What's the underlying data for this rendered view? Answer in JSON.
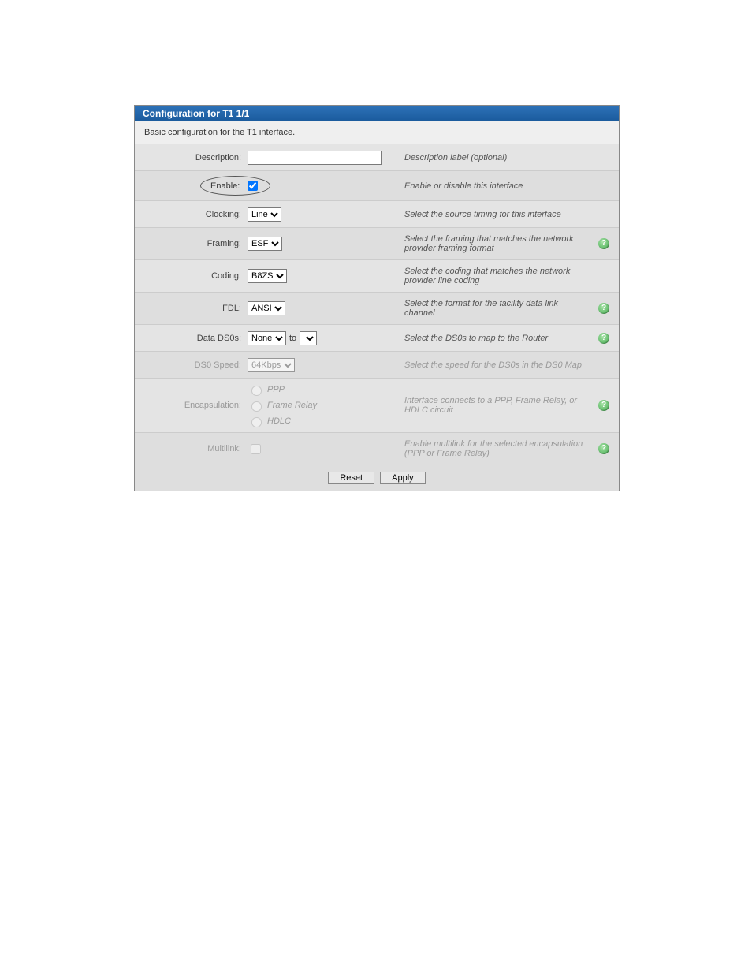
{
  "title": "Configuration for T1 1/1",
  "subhead": "Basic configuration for the T1 interface.",
  "labels": {
    "description": "Description:",
    "enable": "Enable:",
    "clocking": "Clocking:",
    "framing": "Framing:",
    "coding": "Coding:",
    "fdl": "FDL:",
    "data_ds0s": "Data DS0s:",
    "ds0_speed": "DS0 Speed:",
    "encapsulation": "Encapsulation:",
    "multilink": "Multilink:"
  },
  "values": {
    "description": "",
    "enable_checked": true,
    "clocking": "Line",
    "framing": "ESF",
    "coding": "B8ZS",
    "fdl": "ANSI",
    "data_ds0s_from": "None",
    "data_ds0s_to": "",
    "ds0_speed": "64Kbps",
    "encapsulation": "",
    "multilink_checked": false
  },
  "between": {
    "to": "to"
  },
  "options": {
    "encapsulation": [
      "PPP",
      "Frame Relay",
      "HDLC"
    ]
  },
  "help": {
    "description": "Description label (optional)",
    "enable": "Enable or disable this interface",
    "clocking": "Select the source timing for this interface",
    "framing": "Select the framing that matches the network provider framing format",
    "coding": "Select the coding that matches the network provider line coding",
    "fdl": "Select the format for the facility data link channel",
    "data_ds0s": "Select the DS0s to map to the Router",
    "ds0_speed": "Select the speed for the DS0s in the DS0 Map",
    "encapsulation": "Interface connects to a PPP, Frame Relay, or HDLC circuit",
    "multilink": "Enable multilink for the selected encapsulation (PPP or Frame Relay)"
  },
  "buttons": {
    "reset": "Reset",
    "apply": "Apply"
  },
  "icons": {
    "help_glyph": "?"
  }
}
